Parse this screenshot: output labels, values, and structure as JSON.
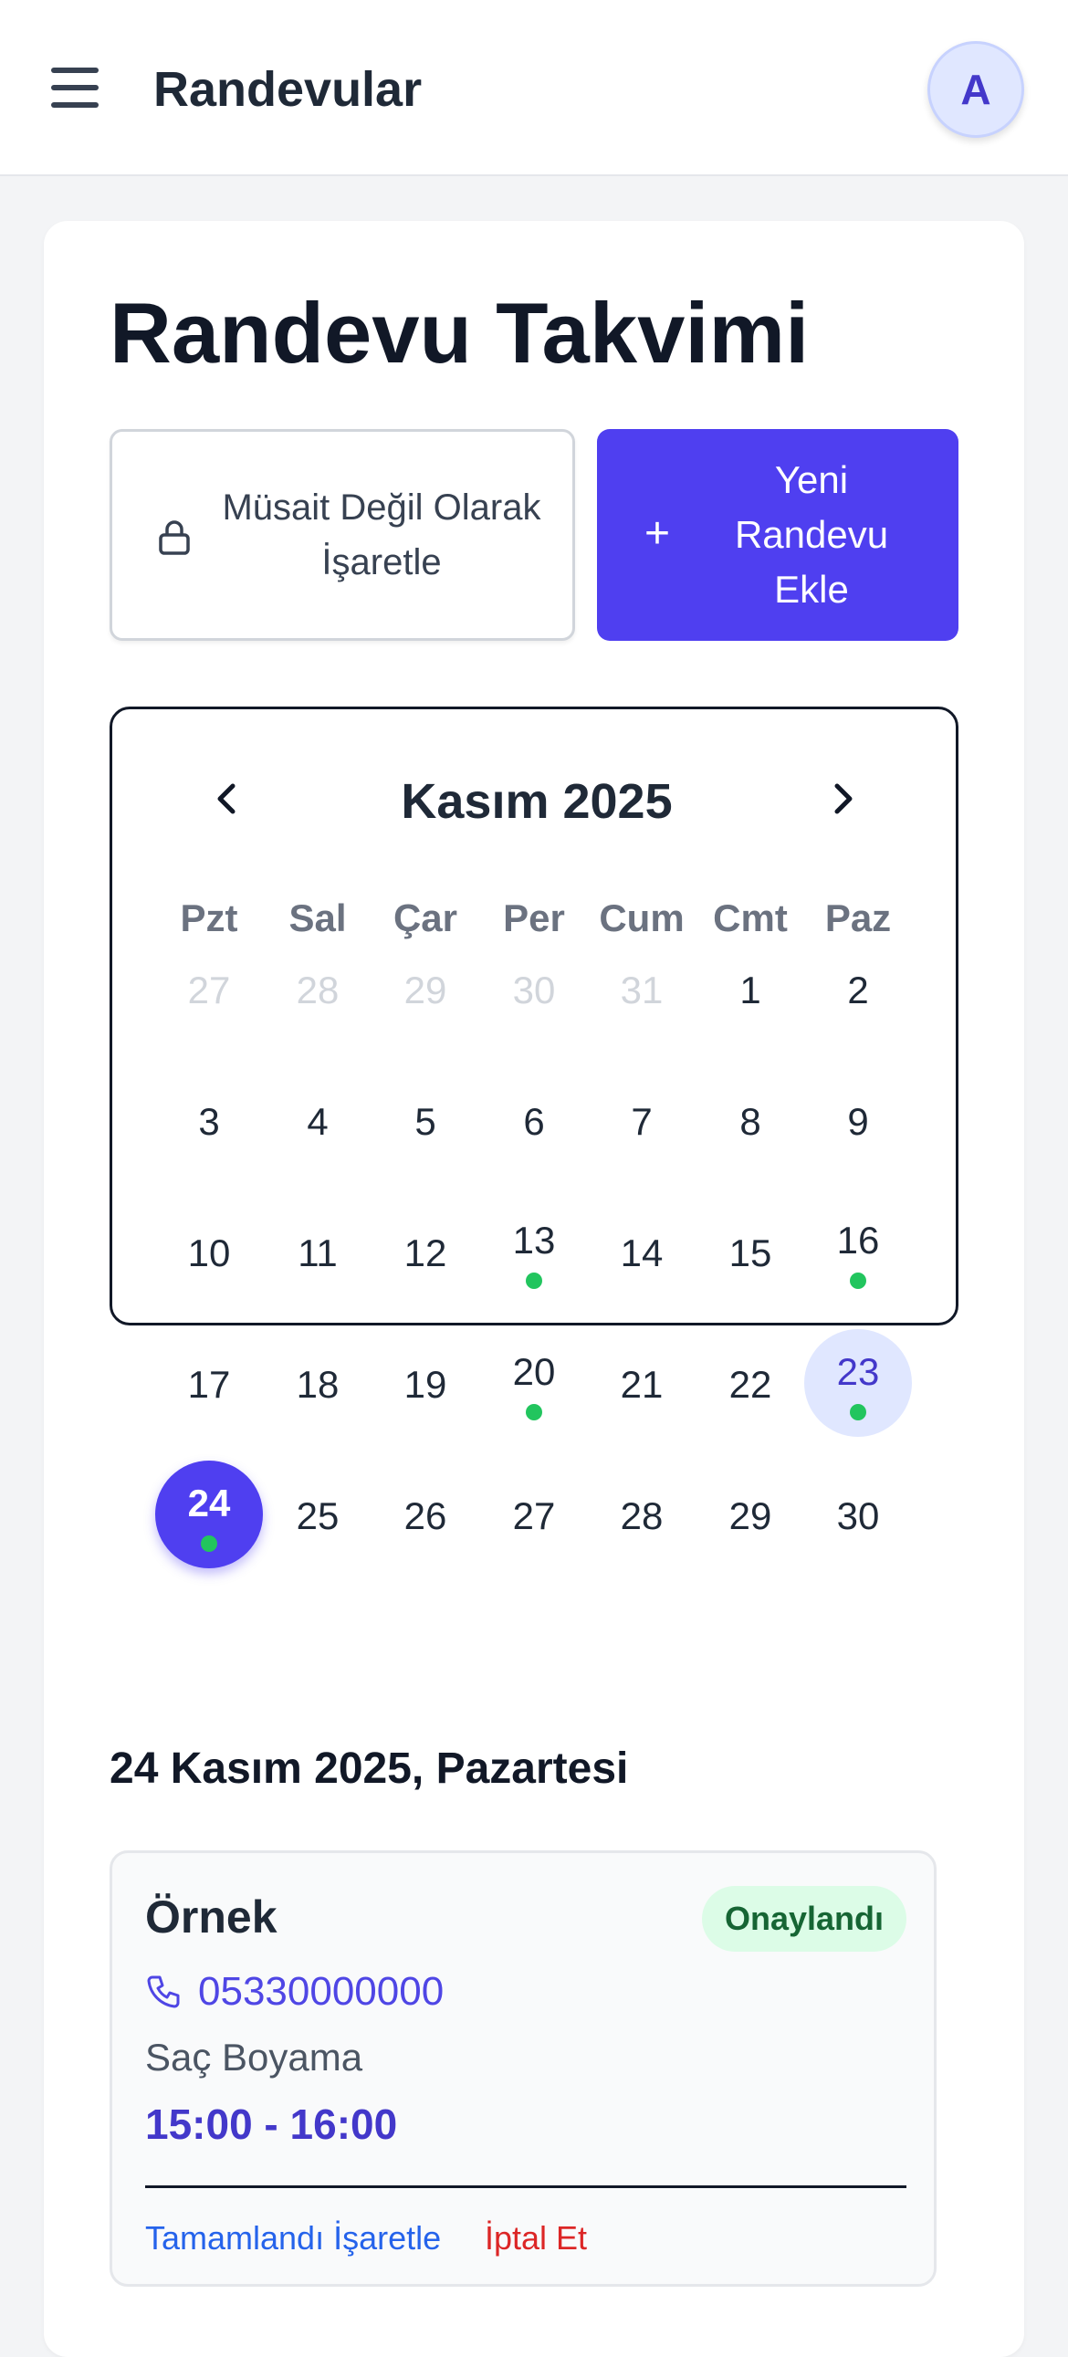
{
  "header": {
    "title": "Randevular",
    "avatar_initial": "A",
    "menu_icon": "hamburger-menu-icon"
  },
  "page": {
    "title": "Randevu Takvimi"
  },
  "actions": {
    "unavailable_label": "Müsait Değil Olarak İşaretle",
    "unavailable_icon": "lock-icon",
    "new_label": "Yeni Randevu Ekle",
    "new_icon": "plus-icon",
    "accent_color": "#4f3ff0"
  },
  "calendar": {
    "month_label": "Kasım 2025",
    "prev_icon": "chevron-left-icon",
    "next_icon": "chevron-right-icon",
    "weekdays": [
      "Pzt",
      "Sal",
      "Çar",
      "Per",
      "Cum",
      "Cmt",
      "Paz"
    ],
    "weeks": [
      [
        {
          "d": "27",
          "muted": true
        },
        {
          "d": "28",
          "muted": true
        },
        {
          "d": "29",
          "muted": true
        },
        {
          "d": "30",
          "muted": true
        },
        {
          "d": "31",
          "muted": true
        },
        {
          "d": "1"
        },
        {
          "d": "2"
        }
      ],
      [
        {
          "d": "3"
        },
        {
          "d": "4"
        },
        {
          "d": "5"
        },
        {
          "d": "6"
        },
        {
          "d": "7"
        },
        {
          "d": "8"
        },
        {
          "d": "9"
        }
      ],
      [
        {
          "d": "10"
        },
        {
          "d": "11"
        },
        {
          "d": "12"
        },
        {
          "d": "13",
          "dot": true
        },
        {
          "d": "14"
        },
        {
          "d": "15"
        },
        {
          "d": "16",
          "dot": true
        }
      ],
      [
        {
          "d": "17"
        },
        {
          "d": "18"
        },
        {
          "d": "19"
        },
        {
          "d": "20",
          "dot": true
        },
        {
          "d": "21"
        },
        {
          "d": "22"
        },
        {
          "d": "23",
          "dot": true,
          "highlight": true
        }
      ],
      [
        {
          "d": "24",
          "dot": true,
          "selected": true
        },
        {
          "d": "25"
        },
        {
          "d": "26"
        },
        {
          "d": "27"
        },
        {
          "d": "28"
        },
        {
          "d": "29"
        },
        {
          "d": "30"
        }
      ]
    ],
    "dot_color": "#22c55e"
  },
  "selected_date_label": "24 Kasım 2025, Pazartesi",
  "appointment": {
    "name": "Örnek",
    "status": "Onaylandı",
    "phone": "05330000000",
    "phone_icon": "phone-icon",
    "service": "Saç Boyama",
    "time": "15:00 - 16:00",
    "complete_label": "Tamamlandı İşaretle",
    "cancel_label": "İptal Et"
  }
}
